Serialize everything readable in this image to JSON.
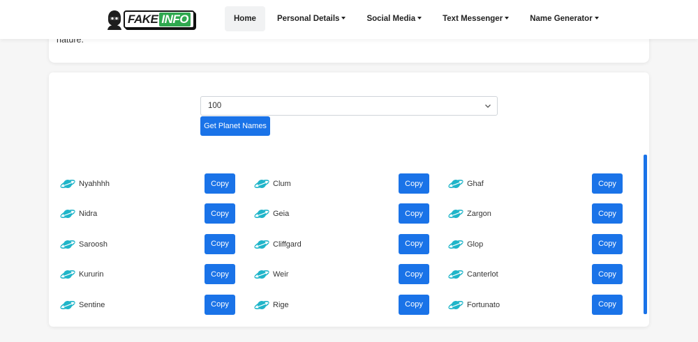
{
  "top_card": {
    "text": "nature."
  },
  "navbar": {
    "logo": {
      "fake": "FAKE",
      "info": "INFO"
    },
    "items": [
      {
        "label": "Home",
        "active": true,
        "dropdown": false
      },
      {
        "label": "Personal Details",
        "active": false,
        "dropdown": true
      },
      {
        "label": "Social Media",
        "active": false,
        "dropdown": true
      },
      {
        "label": "Text Messenger",
        "active": false,
        "dropdown": true
      },
      {
        "label": "Name Generator",
        "active": false,
        "dropdown": true
      }
    ]
  },
  "generator": {
    "select_value": "100",
    "button_label": "Get Planet Names"
  },
  "copy_label": "Copy",
  "names": [
    "Nyahhhh",
    "Clum",
    "Ghaf",
    "Nidra",
    "Geia",
    "Zargon",
    "Saroosh",
    "Cliffgard",
    "Glop",
    "Kururin",
    "Weir",
    "Canterlot",
    "Sentine",
    "Rige",
    "Fortunato"
  ],
  "colors": {
    "accent": "#1a73e8",
    "planet": "#1fb5c9"
  },
  "icons": {
    "planet": "planet-icon",
    "chevron": "chevron-down-icon",
    "caret": "caret-down-icon"
  }
}
